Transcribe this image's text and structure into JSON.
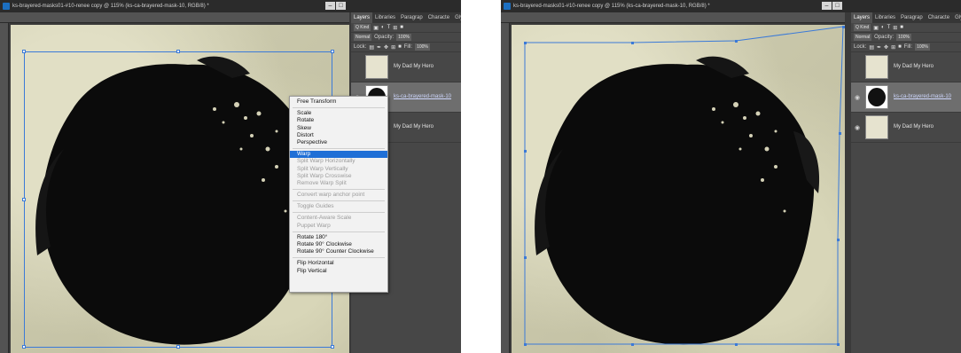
{
  "left": {
    "title": "ks-brayered-masks01-#10-renee copy @ 115% (ks-ca-brayered-mask-10, RGB/8) *",
    "window_buttons": [
      "–",
      "□"
    ],
    "panel": {
      "tabs": [
        "Layers",
        "Libraries",
        "Paragrap",
        "Characte",
        "Glyph"
      ],
      "kind_label": "Q Kind",
      "blend_mode": "Normal",
      "opacity_label": "Opacity:",
      "opacity_value": "100%",
      "lock_label": "Lock:",
      "fill_label": "Fill:",
      "fill_value": "100%",
      "layers": [
        "My Dad My Hero",
        "ks-ca-brayered-mask-10",
        "My Dad My Hero"
      ]
    },
    "context_menu": {
      "free_transform": "Free Transform",
      "scale": "Scale",
      "rotate": "Rotate",
      "skew": "Skew",
      "distort": "Distort",
      "perspective": "Perspective",
      "warp": "Warp",
      "split_horizontal": "Split Warp Horizontally",
      "split_vertical": "Split Warp Vertically",
      "split_crosswise": "Split Warp Crosswise",
      "remove_split": "Remove Warp Split",
      "convert_anchor": "Convert warp anchor point",
      "toggle_guides": "Toggle Guides",
      "content_aware": "Content-Aware Scale",
      "puppet_warp": "Puppet Warp",
      "rotate_180": "Rotate 180°",
      "rotate_cw": "Rotate 90° Clockwise",
      "rotate_ccw": "Rotate 90° Counter Clockwise",
      "flip_h": "Flip Horizontal",
      "flip_v": "Flip Vertical"
    }
  },
  "right": {
    "title": "ks-brayered-masks01-#10-renee copy @ 115% (ks-ca-brayered-mask-10, RGB/8) *",
    "window_buttons": [
      "–",
      "□"
    ],
    "panel": {
      "tabs": [
        "Layers",
        "Libraries",
        "Paragrap",
        "Characte",
        "Glyph"
      ],
      "kind_label": "Q Kind",
      "blend_mode": "Normal",
      "opacity_label": "Opacity:",
      "opacity_value": "100%",
      "lock_label": "Lock:",
      "fill_label": "Fill:",
      "fill_value": "100%",
      "layers": [
        "My Dad My Hero",
        "ks-ca-brayered-mask-10",
        "My Dad My Hero"
      ]
    }
  },
  "colors": {
    "accent": "#1f6fd6",
    "transform_box": "#3b7ad8",
    "ps_dark": "#3a3a3a"
  }
}
